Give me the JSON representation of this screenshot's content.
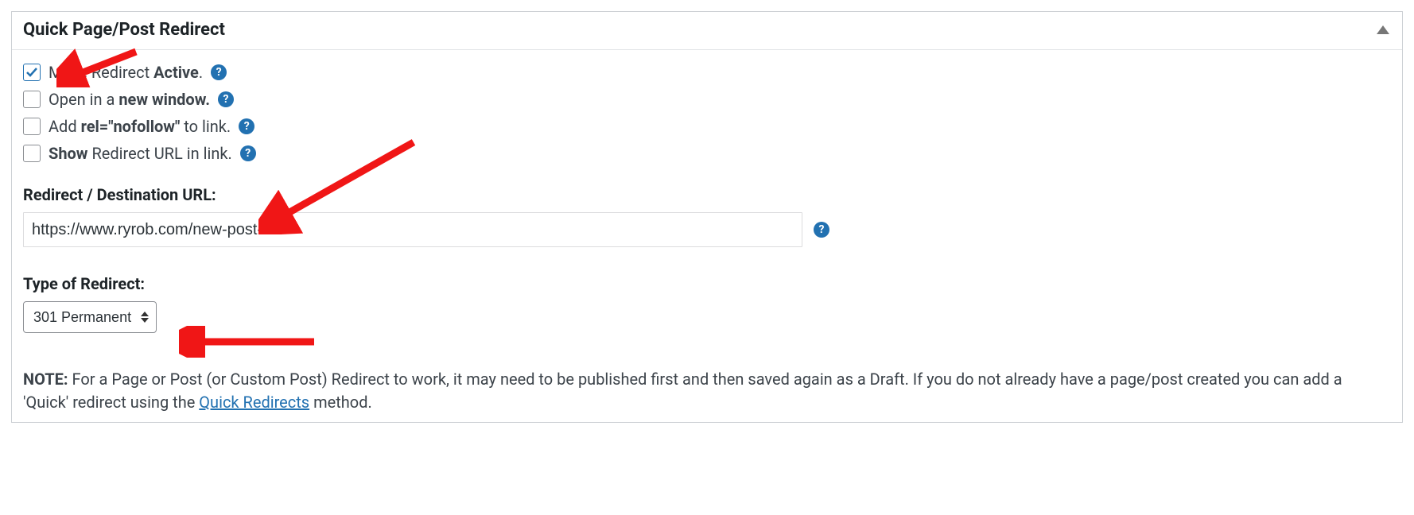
{
  "panel": {
    "title": "Quick Page/Post Redirect"
  },
  "options": {
    "active": {
      "prefix": "Make Redirect ",
      "bold": "Active",
      "suffix": "."
    },
    "new_window": {
      "prefix": "Open in a ",
      "bold": "new window.",
      "suffix": ""
    },
    "nofollow": {
      "prefix": "Add ",
      "bold": "rel=\"nofollow\"",
      "suffix": " to link."
    },
    "show_url": {
      "prefix": "",
      "bold": "Show",
      "suffix": " Redirect URL in link."
    }
  },
  "url_field": {
    "label": "Redirect / Destination URL:",
    "value": "https://www.ryrob.com/new-post-url/"
  },
  "type_field": {
    "label": "Type of Redirect:",
    "selected": "301 Permanent"
  },
  "note": {
    "bold": "NOTE:",
    "text1": " For a Page or Post (or Custom Post) Redirect to work, it may need to be published first and then saved again as a Draft. If you do not already have a page/post created you can add a 'Quick' redirect using the ",
    "link": "Quick Redirects",
    "text2": " method."
  },
  "help_glyph": "?"
}
